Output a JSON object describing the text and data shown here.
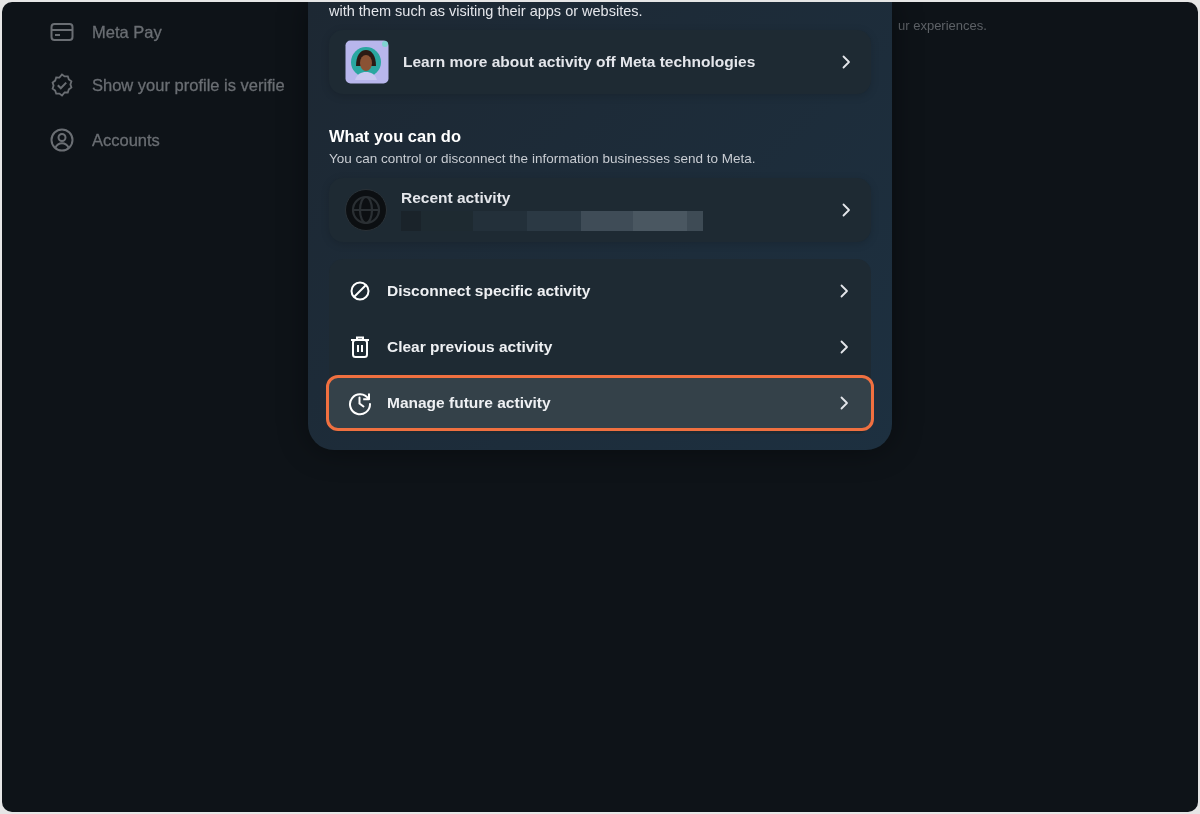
{
  "sidebar": {
    "items": [
      {
        "label": "Meta Pay"
      },
      {
        "label": "Show your profile is verifie"
      },
      {
        "label": "Accounts"
      }
    ]
  },
  "background_text": "ur experiences.",
  "dialog": {
    "intro": "with them such as visiting their apps or websites.",
    "learn_more": {
      "label": "Learn more about activity off Meta technologies"
    },
    "section": {
      "heading": "What you can do",
      "subtitle": "You can control or disconnect the information businesses send to Meta."
    },
    "recent": {
      "label": "Recent activity"
    },
    "actions": [
      {
        "label": "Disconnect specific activity",
        "selected": false
      },
      {
        "label": "Clear previous activity",
        "selected": false
      },
      {
        "label": "Manage future activity",
        "selected": true
      }
    ]
  }
}
